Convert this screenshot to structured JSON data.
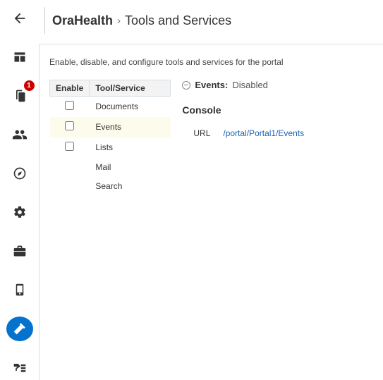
{
  "sidebar": {
    "badge": "1"
  },
  "header": {
    "root": "OraHealth",
    "separator": "›",
    "current": "Tools and Services"
  },
  "panel": {
    "instructions": "Enable, disable, and configure tools and services for the portal",
    "table": {
      "col_enable": "Enable",
      "col_tool": "Tool/Service",
      "rows": [
        {
          "name": "Documents",
          "checkbox": true
        },
        {
          "name": "Events",
          "checkbox": true,
          "selected": true
        },
        {
          "name": "Lists",
          "checkbox": true
        },
        {
          "name": "Mail",
          "checkbox": false
        },
        {
          "name": "Search",
          "checkbox": false
        }
      ]
    },
    "status": {
      "label": "Events:",
      "value": "Disabled"
    },
    "console": {
      "title": "Console",
      "url_label": "URL",
      "url_value": "/portal/Portal1/Events"
    }
  }
}
